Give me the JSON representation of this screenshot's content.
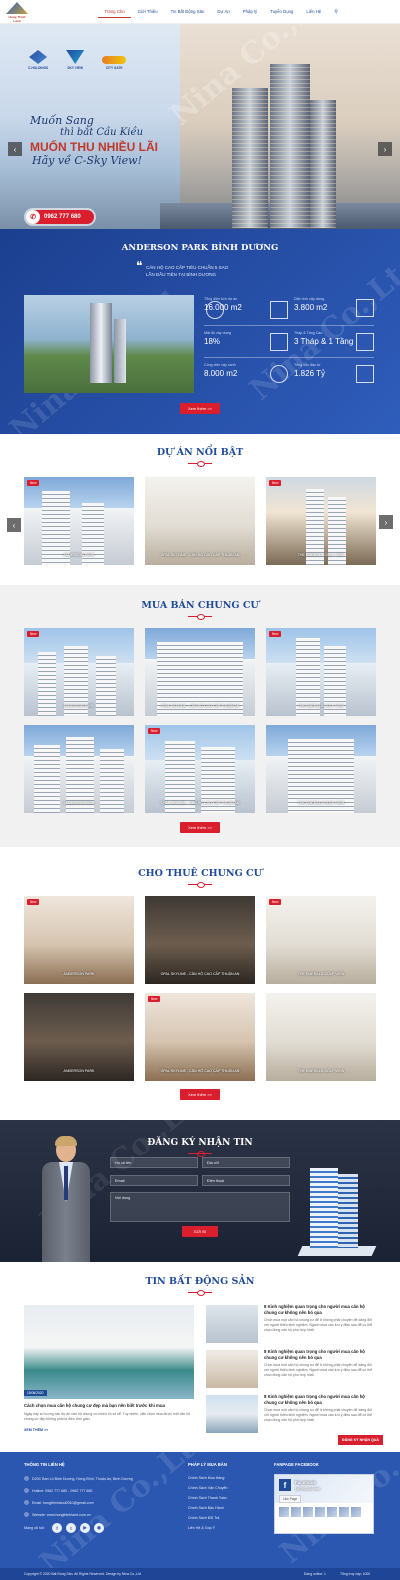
{
  "header": {
    "logo_text": "Hưng Thịnh Land",
    "nav": [
      "Trang Chủ",
      "Giới Thiệu",
      "Tin Bất Động Sản",
      "Dự Án",
      "Pháp lý",
      "Tuyển Dụng",
      "Liên Hệ"
    ],
    "active_index": 0
  },
  "hero": {
    "brands": [
      "C-HOLDINGS",
      "SKY VIEW",
      "CITY GATE"
    ],
    "slogan_line1": "Muốn Sang",
    "slogan_line2": "thì bắt Cầu Kiều",
    "slogan_line3": "MUỐN THU NHIỀU LÃI",
    "slogan_line4": "Hãy về C-Sky View!",
    "hotline": "0962 777 680"
  },
  "anderson": {
    "title": "ANDERSON PARK BÌNH DƯƠNG",
    "quote_line1": "CĂN HỘ CAO CẤP TIÊU CHUẨN 5 SAO",
    "quote_line2": "LẦN ĐẦU TIÊN TẠI BÌNH DƯƠNG",
    "stats": [
      {
        "label": "Tổng diện tích dự án",
        "value": "16.000 m2"
      },
      {
        "label": "Diện tích xây dựng",
        "value": "3.800 m2"
      },
      {
        "label": "Mật độ xây dựng",
        "value": "18%"
      },
      {
        "label": "Tháp & Tầng Cao",
        "value": "3 Tháp & 1 Tầng"
      },
      {
        "label": "Công viên cây xanh",
        "value": "8.000 m2"
      },
      {
        "label": "Tổng vốn đầu tư",
        "value": "1.826 Tỷ"
      }
    ],
    "more": "Xem thêm >>"
  },
  "featured": {
    "title": "DỰ ÁN NỔI BẬT",
    "items": [
      {
        "caption": "ANDERSON PARK",
        "new": "New"
      },
      {
        "caption": "OPAL SKYLINE - CĂN HỘ CAO CẤP THUẬN AN",
        "new": ""
      },
      {
        "caption": "THE EMERALD GOLF VIEW",
        "new": "New"
      }
    ]
  },
  "sale": {
    "title": "MUA BÁN CHUNG CƯ",
    "items": [
      {
        "caption": "ANDERSON PARK",
        "new": "New"
      },
      {
        "caption": "OPAL SKYLINE - CĂN HỘ CAO CẤP THUẬN AN",
        "new": ""
      },
      {
        "caption": "THE EMERALD GOLF VIEW",
        "new": "New"
      },
      {
        "caption": "ANDERSON PARK",
        "new": ""
      },
      {
        "caption": "OPAL SKYLINE - CĂN HỘ CAO CẤP THUẬN AN",
        "new": "New"
      },
      {
        "caption": "THE EMERALD GOLF VIEW",
        "new": ""
      }
    ],
    "more": "Xem thêm >>"
  },
  "rent": {
    "title": "CHO THUÊ CHUNG CƯ",
    "items": [
      {
        "caption": "ANDERSON PARK",
        "new": "New"
      },
      {
        "caption": "OPAL SKYLINE - CĂN HỘ CAO CẤP THUẬN AN",
        "new": ""
      },
      {
        "caption": "THE EMERALD GOLF VIEW",
        "new": "New"
      },
      {
        "caption": "ANDERSON PARK",
        "new": ""
      },
      {
        "caption": "OPAL SKYLINE - CĂN HỘ CAO CẤP THUẬN AN",
        "new": "New"
      },
      {
        "caption": "THE EMERALD GOLF VIEW",
        "new": ""
      }
    ],
    "more": "Xem thêm >>"
  },
  "register": {
    "title": "ĐĂNG KÝ NHẬN TIN",
    "name_placeholder": "Họ và tên",
    "address_placeholder": "Địa chỉ",
    "email_placeholder": "Email",
    "phone_placeholder": "Điện thoại",
    "content_placeholder": "Nội dung",
    "submit": "GỬI ĐI"
  },
  "news": {
    "title": "TIN BẤT ĐỘNG SẢN",
    "main_date": "15/06/2020",
    "main_title": "Cách chọn mua căn hộ chung cư đẹp mà bạn nên biết trước khi mua",
    "main_desc": "Ngày nay số lượng các dự án căn hộ chung cư nhiều vô số kể. Tuy nhiên, việc chọn mua được một căn hộ chung cư đẹp không phải là điều đơn giản.",
    "main_more": "XEM THÊM >>",
    "side": [
      {
        "title": "8 Kinh nghiệm quan trọng cho người mua căn hộ chung cư không nên bỏ qua",
        "desc": "Chọn mua một căn hộ chung cư để ở không phải chuyện dễ dàng đối với người thiếu kinh nghiệm. Người mua cần lưu ý điều sau để có thể chọn đúng căn hộ phù hợp nhất."
      },
      {
        "title": "8 Kinh nghiệm quan trọng cho người mua căn hộ chung cư không nên bỏ qua",
        "desc": "Chọn mua một căn hộ chung cư để ở không phải chuyện dễ dàng đối với người thiếu kinh nghiệm. Người mua cần lưu ý điều sau để có thể chọn đúng căn hộ phù hợp nhất."
      },
      {
        "title": "8 Kinh nghiệm quan trọng cho người mua căn hộ chung cư không nên bỏ qua",
        "desc": "Chọn mua một căn hộ chung cư để ở không phải chuyện dễ dàng đối với người thiếu kinh nghiệm. Người mua cần lưu ý điều sau để có thể chọn đúng căn hộ phù hợp nhất."
      }
    ]
  },
  "footer": {
    "contact_title": "THÔNG TIN LIÊN HỆ",
    "address": "D20C Bạn Lộ Bình Dương, Hưng Định, Thuận An, Bình Dương",
    "hotline": "Hotline: 0962 777 680 - 0962 777 680",
    "email": "Email: hungthinhland2010@gmail.com",
    "website": "Website: www.hungthinhland.com.vn",
    "social_label": "Mạng xã hội:",
    "policy_title": "PHÁP LÝ MUA BÁN",
    "policies": [
      "Chính Sách Mua Hàng",
      "Chính Sách Vận Chuyển",
      "Chính Sách Thanh Toán",
      "Chính Sách Bảo Hành",
      "Chính Sách Đổi Trả",
      "Liên Hệ & Góp Ý"
    ],
    "fanpage_title": "FANPAGE FACEBOOK",
    "fb_name": "Facebook",
    "fb_likes": "145,893,064 likes",
    "fb_like_btn": "Like Page",
    "register_badge": "ĐĂNG KÝ NHẬN QUÀ",
    "copyright": "Copyright © 2020 Bất Động Sản. All Rights Reserved. Design by Nina Co.,Ltd",
    "online": "Đang online: 1",
    "visits": "Tổng truy cập: 1000"
  },
  "watermark": "Nina Co.,Ltd",
  "colors": {
    "primary": "#1f4b99",
    "accent": "#d91e2e",
    "band": "#2b57b0"
  }
}
